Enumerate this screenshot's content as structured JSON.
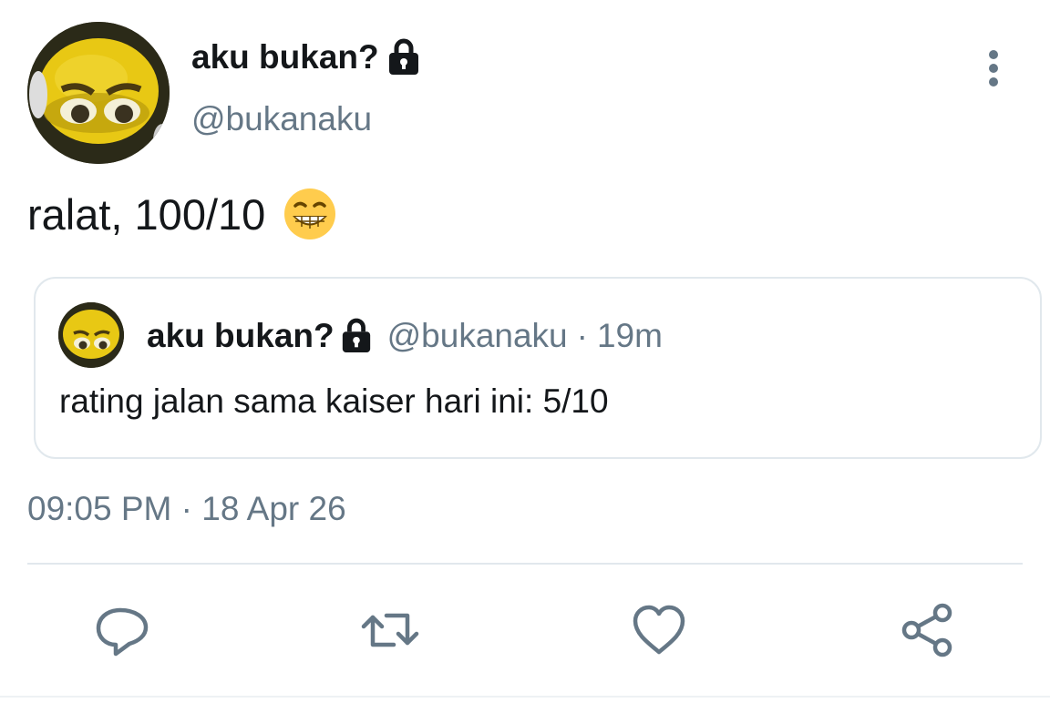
{
  "tweet": {
    "display_name": "aku bukan?",
    "handle": "@bukanaku",
    "text": "ralat, 100/10",
    "emoji": "grinning-face-emoji",
    "timestamp": "09:05 PM · 18 Apr 26",
    "protected": true
  },
  "quoted_tweet": {
    "display_name": "aku bukan?",
    "handle": "@bukanaku",
    "separator": "·",
    "age": "19m",
    "text": "rating jalan sama kaiser hari ini: 5/10"
  },
  "actions": [
    {
      "name": "reply",
      "icon": "reply-icon"
    },
    {
      "name": "retweet",
      "icon": "retweet-icon"
    },
    {
      "name": "like",
      "icon": "heart-icon"
    },
    {
      "name": "share",
      "icon": "share-icon"
    }
  ],
  "colors": {
    "text": "#14171a",
    "secondary": "#657786",
    "border": "#e1e8ed",
    "icon": "#657786"
  }
}
